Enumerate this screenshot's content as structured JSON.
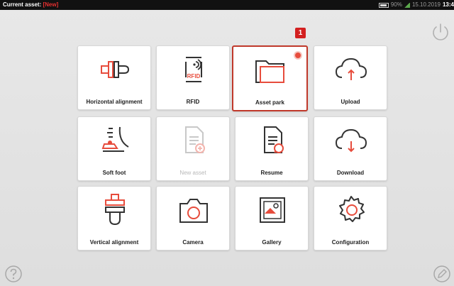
{
  "status_bar": {
    "asset_label": "Current asset:",
    "asset_value": "[New]",
    "battery": "90%",
    "date": "15.10.2019",
    "time": "13:4"
  },
  "callout": {
    "number": "1"
  },
  "tiles": [
    {
      "label": "Horizontal alignment",
      "icon": "horizontal-alignment-icon"
    },
    {
      "label": "RFID",
      "icon": "rfid-icon"
    },
    {
      "label": "Asset park",
      "icon": "folder-icon",
      "selected": true
    },
    {
      "label": "Upload",
      "icon": "cloud-upload-icon"
    },
    {
      "label": "Soft foot",
      "icon": "soft-foot-icon"
    },
    {
      "label": "New asset",
      "icon": "new-asset-icon",
      "disabled": true
    },
    {
      "label": "Resume",
      "icon": "resume-icon"
    },
    {
      "label": "Download",
      "icon": "cloud-download-icon"
    },
    {
      "label": "Vertical alignment",
      "icon": "vertical-alignment-icon"
    },
    {
      "label": "Camera",
      "icon": "camera-icon"
    },
    {
      "label": "Gallery",
      "icon": "gallery-icon"
    },
    {
      "label": "Configuration",
      "icon": "gear-icon"
    }
  ],
  "colors": {
    "accent": "#e74c3c",
    "selection": "#c0392b"
  }
}
